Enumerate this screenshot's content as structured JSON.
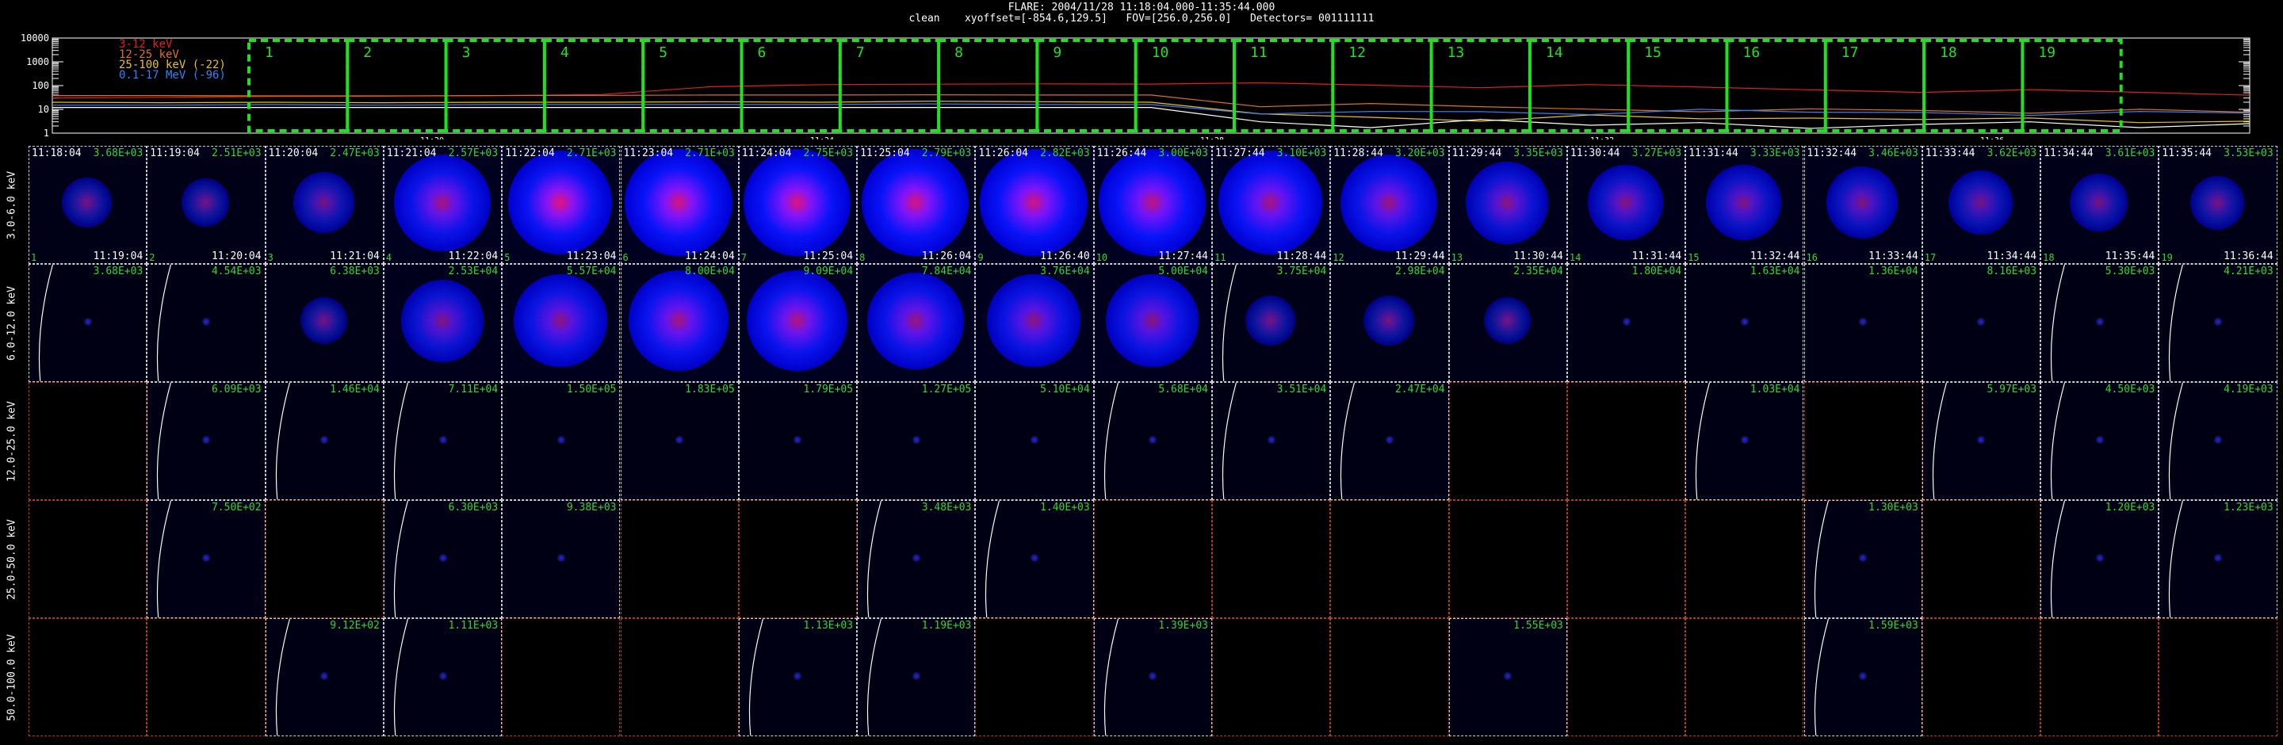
{
  "header": {
    "line1": "FLARE: 2004/11/28 11:18:04.000-11:35:44.000",
    "line2": "clean    xyoffset=[-854.6,129.5]   FOV=[256.0,256.0]   Detectors= 001111111"
  },
  "chart_data": [
    {
      "type": "line",
      "legend_placement": "top-left",
      "ylabels": [
        "10000",
        "1000",
        "100",
        "10",
        "1"
      ],
      "log_y": true,
      "ylim": [
        1,
        10000
      ],
      "xtick_labels": [
        "11:20",
        "11:24",
        "11:28",
        "11:32",
        "11:36"
      ],
      "series": [
        {
          "name": "3-12 keV",
          "color": "#e02020",
          "values": [
            30,
            32,
            35,
            36,
            38,
            42,
            90,
            110,
            115,
            118,
            116,
            112,
            105,
            95,
            88,
            80,
            72,
            65,
            58,
            52,
            46
          ]
        },
        {
          "name": "12-25 keV",
          "color": "#e07020",
          "values": [
            38,
            38,
            37,
            37,
            38,
            39,
            40,
            40,
            41,
            40,
            40,
            15,
            14,
            12,
            11,
            10,
            9,
            9,
            8,
            8,
            7
          ]
        },
        {
          "name": "25-100 keV (-22)",
          "color": "#e8c020",
          "values": [
            20,
            19,
            20,
            19,
            20,
            20,
            21,
            20,
            22,
            21,
            20,
            6,
            5,
            4,
            5,
            4,
            5,
            3,
            4,
            3,
            4
          ]
        },
        {
          "name": "0.1-17 MeV (-96)",
          "color": "#3080ff",
          "values": [
            15,
            15,
            16,
            15,
            16,
            16,
            16,
            16,
            17,
            16,
            16,
            8,
            7,
            8,
            7,
            8,
            7,
            8,
            7,
            7,
            7
          ]
        },
        {
          "name": "",
          "color": "#ffffff",
          "values": [
            12,
            12,
            12,
            12,
            12,
            12,
            12,
            12,
            12,
            12,
            12,
            3,
            2,
            3,
            2,
            3,
            2,
            2,
            3,
            2,
            2
          ]
        }
      ],
      "intervals": [
        "1",
        "2",
        "3",
        "4",
        "5",
        "6",
        "7",
        "8",
        "9",
        "10",
        "11",
        "12",
        "13",
        "14",
        "15",
        "16",
        "17",
        "18",
        "19"
      ]
    }
  ],
  "rows": [
    {
      "label": "3.0-6.0 keV",
      "cells": [
        {
          "s": "11:18:04",
          "v": "3.68E+03",
          "e": "11:19:04",
          "n": "1",
          "i": 0.15,
          "c": 0
        },
        {
          "s": "11:19:04",
          "v": "2.51E+03",
          "e": "11:20:04",
          "n": "2",
          "i": 0.12,
          "c": 0
        },
        {
          "s": "11:20:04",
          "v": "2.47E+03",
          "e": "11:21:04",
          "n": "3",
          "i": 0.3,
          "c": 0
        },
        {
          "s": "11:21:04",
          "v": "2.57E+03",
          "e": "11:22:04",
          "n": "4",
          "i": 0.8,
          "c": 0.4
        },
        {
          "s": "11:22:04",
          "v": "2.71E+03",
          "e": "11:23:04",
          "n": "5",
          "i": 0.9,
          "c": 0.9
        },
        {
          "s": "11:23:04",
          "v": "2.71E+03",
          "e": "11:24:04",
          "n": "6",
          "i": 0.95,
          "c": 0.8
        },
        {
          "s": "11:24:04",
          "v": "2.75E+03",
          "e": "11:25:04",
          "n": "7",
          "i": 0.95,
          "c": 0.85
        },
        {
          "s": "11:25:04",
          "v": "2.79E+03",
          "e": "11:26:04",
          "n": "8",
          "i": 0.95,
          "c": 0.8
        },
        {
          "s": "11:26:04",
          "v": "2.82E+03",
          "e": "11:26:40",
          "n": "9",
          "i": 0.95,
          "c": 0.75
        },
        {
          "s": "11:26:44",
          "v": "3.00E+03",
          "e": "11:27:44",
          "n": "10",
          "i": 0.95,
          "c": 0.6
        },
        {
          "s": "11:27:44",
          "v": "3.10E+03",
          "e": "11:28:44",
          "n": "11",
          "i": 0.9,
          "c": 0.4
        },
        {
          "s": "11:28:44",
          "v": "3.20E+03",
          "e": "11:29:44",
          "n": "12",
          "i": 0.8,
          "c": 0.3
        },
        {
          "s": "11:29:44",
          "v": "3.35E+03",
          "e": "11:30:44",
          "n": "13",
          "i": 0.6,
          "c": 0.2
        },
        {
          "s": "11:30:44",
          "v": "3.27E+03",
          "e": "11:31:44",
          "n": "14",
          "i": 0.5,
          "c": 0.15
        },
        {
          "s": "11:31:44",
          "v": "3.33E+03",
          "e": "11:32:44",
          "n": "15",
          "i": 0.5,
          "c": 0.1
        },
        {
          "s": "11:32:44",
          "v": "3.46E+03",
          "e": "11:33:44",
          "n": "16",
          "i": 0.45,
          "c": 0.1
        },
        {
          "s": "11:33:44",
          "v": "3.62E+03",
          "e": "11:34:44",
          "n": "17",
          "i": 0.35,
          "c": 0
        },
        {
          "s": "11:34:44",
          "v": "3.61E+03",
          "e": "11:35:44",
          "n": "18",
          "i": 0.25,
          "c": 0
        },
        {
          "s": "11:35:44",
          "v": "3.53E+03",
          "e": "11:36:44",
          "n": "19",
          "i": 0.2,
          "c": 0
        }
      ]
    },
    {
      "label": "6.0-12.0 keV",
      "cells": [
        {
          "v": "3.68E+03",
          "i": 0.05,
          "c": 0,
          "limb": true
        },
        {
          "v": "4.54E+03",
          "i": 0.05,
          "c": 0,
          "limb": true
        },
        {
          "v": "6.38E+03",
          "i": 0.1,
          "c": 0
        },
        {
          "v": "2.53E+04",
          "i": 0.6,
          "c": 0.1
        },
        {
          "v": "5.57E+04",
          "i": 0.75,
          "c": 0.2
        },
        {
          "v": "8.00E+04",
          "i": 0.85,
          "c": 0.4
        },
        {
          "v": "9.09E+04",
          "i": 0.85,
          "c": 0.5
        },
        {
          "v": "7.84E+04",
          "i": 0.8,
          "c": 0.3
        },
        {
          "v": "3.76E+04",
          "i": 0.75,
          "c": 0.2
        },
        {
          "v": "5.00E+04",
          "i": 0.75,
          "c": 0.15
        },
        {
          "v": "3.75E+04",
          "i": 0.15,
          "c": 0,
          "limb": true
        },
        {
          "v": "2.98E+04",
          "i": 0.15,
          "c": 0
        },
        {
          "v": "2.35E+04",
          "i": 0.1,
          "c": 0
        },
        {
          "v": "1.80E+04",
          "i": 0.05,
          "c": 0
        },
        {
          "v": "1.63E+04",
          "i": 0.05,
          "c": 0
        },
        {
          "v": "1.36E+04",
          "i": 0.05,
          "c": 0
        },
        {
          "v": "8.16E+03",
          "i": 0.05,
          "c": 0
        },
        {
          "v": "5.30E+03",
          "i": 0.05,
          "c": 0,
          "limb": true
        },
        {
          "v": "4.21E+03",
          "i": 0.05,
          "c": 0,
          "limb": true
        }
      ]
    },
    {
      "label": "12.0-25.0 keV",
      "cells": [
        {
          "blank": true
        },
        {
          "v": "6.09E+03",
          "i": 0.05,
          "c": 0,
          "limb": true
        },
        {
          "v": "1.46E+04",
          "i": 0.05,
          "c": 0,
          "limb": true
        },
        {
          "v": "7.11E+04",
          "i": 0.05,
          "c": 0,
          "limb": true
        },
        {
          "v": "1.50E+05",
          "i": 0.05,
          "c": 0
        },
        {
          "v": "1.83E+05",
          "i": 0.05,
          "c": 0
        },
        {
          "v": "1.79E+05",
          "i": 0.05,
          "c": 0
        },
        {
          "v": "1.27E+05",
          "i": 0.05,
          "c": 0
        },
        {
          "v": "5.10E+04",
          "i": 0.05,
          "c": 0
        },
        {
          "v": "5.68E+04",
          "i": 0.05,
          "c": 0,
          "limb": true
        },
        {
          "v": "3.51E+04",
          "i": 0.05,
          "c": 0,
          "limb": true
        },
        {
          "v": "2.47E+04",
          "i": 0.05,
          "c": 0,
          "limb": true
        },
        {
          "blank": true
        },
        {
          "blank": true
        },
        {
          "v": "1.03E+04",
          "i": 0.05,
          "c": 0,
          "limb": true
        },
        {
          "blank": true
        },
        {
          "v": "5.97E+03",
          "i": 0.05,
          "c": 0,
          "limb": true
        },
        {
          "v": "4.50E+03",
          "i": 0.05,
          "c": 0,
          "limb": true
        },
        {
          "v": "4.19E+03",
          "i": 0.05,
          "c": 0,
          "limb": true
        }
      ]
    },
    {
      "label": "25.0-50.0 keV",
      "cells": [
        {
          "blank": true
        },
        {
          "v": "7.50E+02",
          "i": 0.05,
          "c": 0,
          "limb": true
        },
        {
          "blank": true
        },
        {
          "v": "6.30E+03",
          "i": 0.05,
          "c": 0,
          "limb": true
        },
        {
          "v": "9.38E+03",
          "i": 0.05,
          "c": 0
        },
        {
          "blank": true
        },
        {
          "blank": true
        },
        {
          "v": "3.48E+03",
          "i": 0.05,
          "c": 0,
          "limb": true
        },
        {
          "v": "1.40E+03",
          "i": 0.05,
          "c": 0,
          "limb": true
        },
        {
          "blank": true
        },
        {
          "blank": true
        },
        {
          "blank": true
        },
        {
          "blank": true
        },
        {
          "blank": true
        },
        {
          "blank": true
        },
        {
          "v": "1.30E+03",
          "i": 0.05,
          "c": 0,
          "limb": true
        },
        {
          "blank": true
        },
        {
          "v": "1.20E+03",
          "i": 0.05,
          "c": 0,
          "limb": true
        },
        {
          "v": "1.23E+03",
          "i": 0.05,
          "c": 0,
          "limb": true
        }
      ]
    },
    {
      "label": "50.0-100.0 keV",
      "cells": [
        {
          "blank": true
        },
        {
          "blank": true
        },
        {
          "v": "9.12E+02",
          "i": 0.05,
          "c": 0,
          "limb": true
        },
        {
          "v": "1.11E+03",
          "i": 0.05,
          "c": 0,
          "limb": true
        },
        {
          "blank": true
        },
        {
          "blank": true
        },
        {
          "v": "1.13E+03",
          "i": 0.05,
          "c": 0,
          "limb": true
        },
        {
          "v": "1.19E+03",
          "i": 0.05,
          "c": 0,
          "limb": true
        },
        {
          "blank": true
        },
        {
          "v": "1.39E+03",
          "i": 0.05,
          "c": 0,
          "limb": true
        },
        {
          "blank": true
        },
        {
          "blank": true
        },
        {
          "v": "1.55E+03",
          "i": 0.05,
          "c": 0
        },
        {
          "blank": true
        },
        {
          "blank": true
        },
        {
          "v": "1.59E+03",
          "i": 0.05,
          "c": 0,
          "limb": true
        },
        {
          "blank": true
        },
        {
          "blank": true
        },
        {
          "blank": true
        }
      ]
    }
  ]
}
